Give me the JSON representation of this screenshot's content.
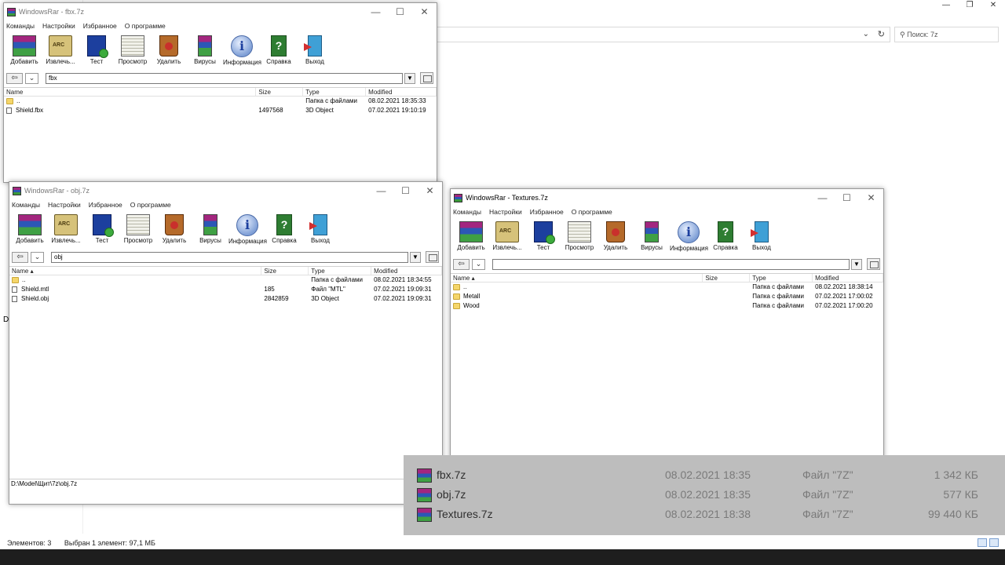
{
  "explorer": {
    "search_placeholder": "Поиск: 7z",
    "status": {
      "items": "Элементов: 3",
      "selected": "Выбран 1 элемент: 97,1 МБ"
    },
    "partial_letter": "D"
  },
  "menu": [
    "Команды",
    "Настройки",
    "Избранное",
    "О программе"
  ],
  "toolbar": [
    "Добавить",
    "Извлечь...",
    "Тест",
    "Просмотр",
    "Удалить",
    "Вирусы",
    "Информация",
    "Справка",
    "Выход"
  ],
  "columns": {
    "name": "Name",
    "size": "Size",
    "type": "Type",
    "modified": "Modified"
  },
  "win_fbx": {
    "title": "WindowsRar - fbx.7z",
    "path": "fbx",
    "rows": [
      {
        "name": "..",
        "size": "",
        "type": "Папка с файлами",
        "modified": "08.02.2021 18:35:33"
      },
      {
        "name": "Shield.fbx",
        "size": "1497568",
        "type": "3D Object",
        "modified": "07.02.2021 19:10:19"
      }
    ]
  },
  "win_obj": {
    "title": "WindowsRar - obj.7z",
    "path": "obj",
    "rows": [
      {
        "name": "..",
        "size": "",
        "type": "Папка с файлами",
        "modified": "08.02.2021 18:34:55"
      },
      {
        "name": "Shield.mtl",
        "size": "185",
        "type": "Файл \"MTL\"",
        "modified": "07.02.2021 19:09:31"
      },
      {
        "name": "Shield.obj",
        "size": "2842859",
        "type": "3D Object",
        "modified": "07.02.2021 19:09:31"
      }
    ],
    "status": "D:\\Model\\Щит\\7z\\obj.7z"
  },
  "win_tex": {
    "title": "WindowsRar - Textures.7z",
    "path": "",
    "rows": [
      {
        "name": "..",
        "size": "",
        "type": "Папка с файлами",
        "modified": "08.02.2021 18:38:14"
      },
      {
        "name": "Metall",
        "size": "",
        "type": "Папка с файлами",
        "modified": "07.02.2021 17:00:02"
      },
      {
        "name": "Wood",
        "size": "",
        "type": "Папка с файлами",
        "modified": "07.02.2021 17:00:20"
      }
    ]
  },
  "archives": [
    {
      "name": "fbx.7z",
      "date": "08.02.2021 18:35",
      "type": "Файл \"7Z\"",
      "size": "1 342 КБ"
    },
    {
      "name": "obj.7z",
      "date": "08.02.2021 18:35",
      "type": "Файл \"7Z\"",
      "size": "577 КБ"
    },
    {
      "name": "Textures.7z",
      "date": "08.02.2021 18:38",
      "type": "Файл \"7Z\"",
      "size": "99 440 КБ"
    }
  ]
}
